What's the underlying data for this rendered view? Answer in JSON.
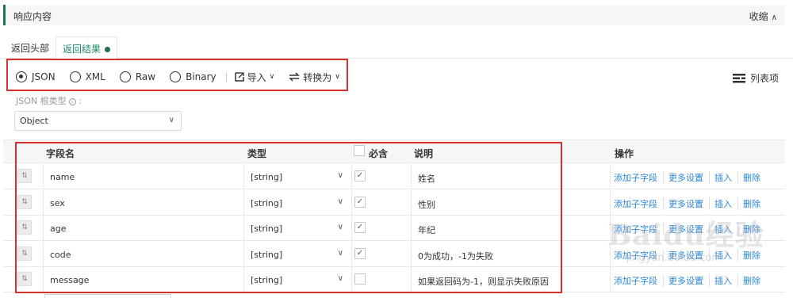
{
  "section": {
    "title": "响应内容",
    "collapse_label": "收缩"
  },
  "tabs": {
    "headers": "返回头部",
    "results": "返回结果"
  },
  "format_bar": {
    "options": [
      "JSON",
      "XML",
      "Raw",
      "Binary"
    ],
    "selected": "JSON",
    "import_label": "导入",
    "convert_label": "转换为",
    "list_mode_label": "列表项"
  },
  "json_root": {
    "label": "JSON 根类型",
    "info_icon": "info-icon",
    "value": "Object"
  },
  "table": {
    "headers": {
      "field": "字段名",
      "type": "类型",
      "required": "必含",
      "desc": "说明",
      "actions": "操作"
    },
    "rows": [
      {
        "name": "name",
        "type": "[string]",
        "required": true,
        "desc": "姓名"
      },
      {
        "name": "sex",
        "type": "[string]",
        "required": true,
        "desc": "性别"
      },
      {
        "name": "age",
        "type": "[string]",
        "required": true,
        "desc": "年纪"
      },
      {
        "name": "code",
        "type": "[string]",
        "required": true,
        "desc": "0为成功，-1为失败"
      },
      {
        "name": "message",
        "type": "[string]",
        "required": false,
        "desc": "如果返回码为-1，则显示失败原因"
      }
    ],
    "row_actions": {
      "add_child": "添加子字段",
      "more": "更多设置",
      "insert": "插入",
      "delete": "删除"
    }
  },
  "watermark": {
    "main": "Baidu经验",
    "sub": "jingyan.baidu.com"
  },
  "colors": {
    "accent": "#1f6f55",
    "link": "#2c86d6",
    "highlight": "#d9302c"
  }
}
